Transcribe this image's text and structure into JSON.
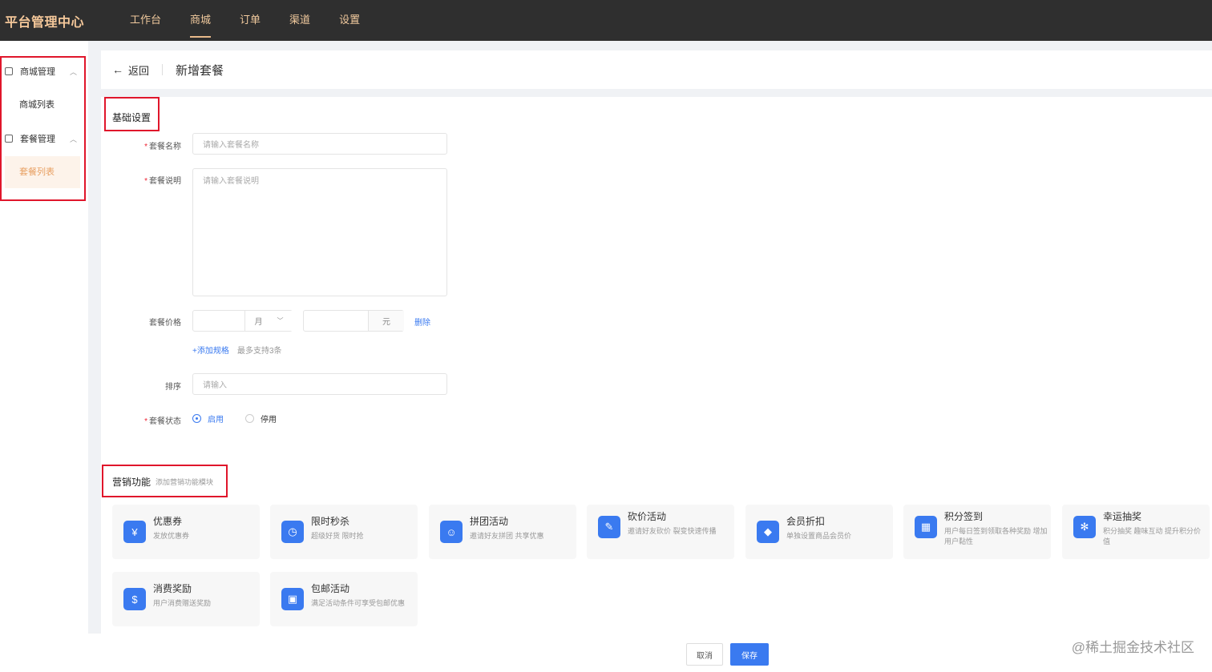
{
  "app": {
    "title": "平台管理中心"
  },
  "nav": [
    {
      "label": "工作台",
      "active": false
    },
    {
      "label": "商城",
      "active": true
    },
    {
      "label": "订单",
      "active": false
    },
    {
      "label": "渠道",
      "active": false
    },
    {
      "label": "设置",
      "active": false
    }
  ],
  "sidebar": {
    "groups": [
      {
        "label": "商城管理",
        "items": [
          {
            "label": "商城列表",
            "active": false
          }
        ]
      },
      {
        "label": "套餐管理",
        "items": [
          {
            "label": "套餐列表",
            "active": true
          }
        ]
      }
    ]
  },
  "header": {
    "back_label": "返回",
    "title": "新增套餐"
  },
  "form": {
    "section_title": "基础设置",
    "name": {
      "label": "套餐名称",
      "placeholder": "请输入套餐名称",
      "required": true
    },
    "desc": {
      "label": "套餐说明",
      "placeholder": "请输入套餐说明",
      "required": true
    },
    "price": {
      "label": "套餐价格",
      "unit_select": "月",
      "suffix": "元",
      "delete_label": "删除"
    },
    "add_spec": {
      "label": "+添加规格",
      "hint": "最多支持3条"
    },
    "sort": {
      "label": "排序",
      "placeholder": "请输入"
    },
    "status": {
      "label": "套餐状态",
      "required": true,
      "options": [
        {
          "label": "启用",
          "checked": true
        },
        {
          "label": "停用",
          "checked": false
        }
      ]
    }
  },
  "marketing": {
    "title": "营销功能",
    "subtitle": "添加营销功能模块",
    "features": [
      {
        "name": "优惠券",
        "desc": "发放优惠券",
        "icon": "coupon-icon"
      },
      {
        "name": "限时秒杀",
        "desc": "超级好货 限时抢",
        "icon": "clock-icon"
      },
      {
        "name": "拼团活动",
        "desc": "邀请好友拼团 共享优惠",
        "icon": "group-icon"
      },
      {
        "name": "砍价活动",
        "desc": "邀请好友砍价 裂变快速传播",
        "icon": "tag-icon"
      },
      {
        "name": "会员折扣",
        "desc": "单独设置商品会员价",
        "icon": "diamond-icon"
      },
      {
        "name": "积分签到",
        "desc": "用户每日签到领取各种奖励 增加用户黏性",
        "icon": "calendar-icon"
      },
      {
        "name": "幸运抽奖",
        "desc": "积分抽奖 趣味互动 提升积分价值",
        "icon": "wheel-icon"
      },
      {
        "name": "消费奖励",
        "desc": "用户消费赠送奖励",
        "icon": "money-bag-icon"
      },
      {
        "name": "包邮活动",
        "desc": "满足活动条件可享受包邮优惠",
        "icon": "shipping-icon"
      }
    ]
  },
  "footer": {
    "cancel_label": "取消",
    "save_label": "保存"
  },
  "watermark": "@稀土掘金技术社区",
  "colors": {
    "primary": "#3a7af0",
    "topbar": "#2f2f2f",
    "nav_text": "#f0c99d",
    "highlight_box": "#e0162b"
  }
}
